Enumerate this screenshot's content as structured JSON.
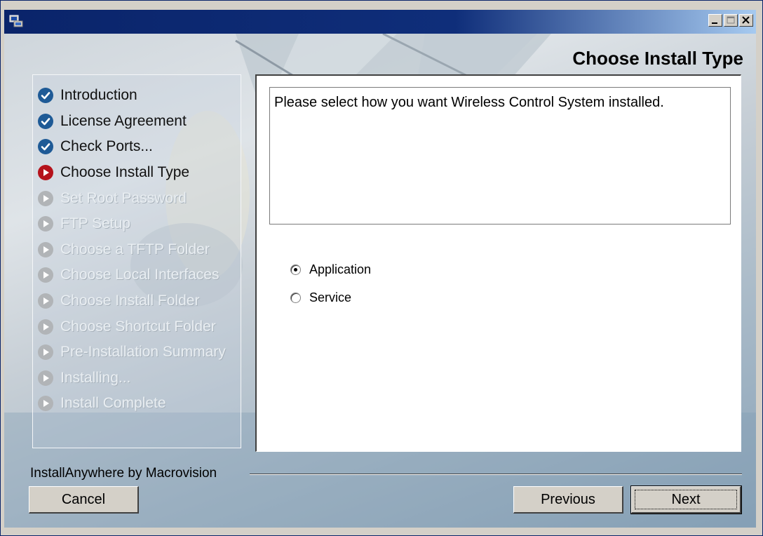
{
  "window": {
    "controls": [
      {
        "name": "minimize",
        "icon": "minimize-icon"
      },
      {
        "name": "maximize",
        "icon": "maximize-icon"
      },
      {
        "name": "close",
        "icon": "close-icon"
      }
    ]
  },
  "header": {
    "title": "Choose Install Type"
  },
  "steps": [
    {
      "label": "Introduction",
      "state": "done"
    },
    {
      "label": "License Agreement",
      "state": "done"
    },
    {
      "label": "Check Ports...",
      "state": "done"
    },
    {
      "label": "Choose Install Type",
      "state": "current"
    },
    {
      "label": "Set Root Password",
      "state": "pending"
    },
    {
      "label": "FTP Setup",
      "state": "pending"
    },
    {
      "label": "Choose a TFTP Folder",
      "state": "pending"
    },
    {
      "label": "Choose Local Interfaces",
      "state": "pending"
    },
    {
      "label": "Choose Install Folder",
      "state": "pending"
    },
    {
      "label": "Choose Shortcut Folder",
      "state": "pending"
    },
    {
      "label": "Pre-Installation Summary",
      "state": "pending"
    },
    {
      "label": "Installing...",
      "state": "pending"
    },
    {
      "label": "Install Complete",
      "state": "pending"
    }
  ],
  "main": {
    "description": "Please select how you want Wireless Control System installed.",
    "options": [
      {
        "label": "Application",
        "checked": true
      },
      {
        "label": "Service",
        "checked": false
      }
    ]
  },
  "footer": {
    "brand": "InstallAnywhere by Macrovision",
    "cancel_label": "Cancel",
    "previous_label": "Previous",
    "next_label": "Next"
  }
}
